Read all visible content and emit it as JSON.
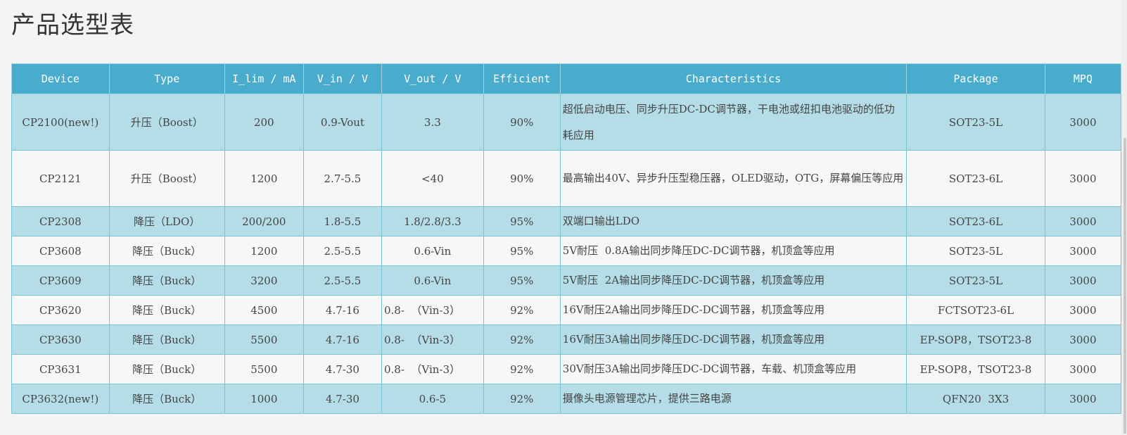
{
  "page": {
    "title": "产品选型表"
  },
  "table": {
    "headers": [
      "Device",
      "Type",
      "I_lim / mA",
      "V_in / V",
      "V_out / V",
      "Efficient",
      "Characteristics",
      "Package",
      "MPQ"
    ],
    "rows": [
      [
        "CP2100(new!)",
        "升压（Boost）",
        "200",
        "0.9-Vout",
        "3.3",
        "90%",
        "超低启动电压、同步升压DC-DC调节器，干电池或纽扣电池驱动的低功耗应用",
        "SOT23-5L",
        "3000"
      ],
      [
        "CP2121",
        "升压（Boost）",
        "1200",
        "2.7-5.5",
        "<40",
        "90%",
        "最高输出40V、异步升压型稳压器，OLED驱动，OTG，屏幕偏压等应用",
        "SOT23-6L",
        "3000"
      ],
      [
        "CP2308",
        "降压（LDO）",
        "200/200",
        "1.8-5.5",
        "1.8/2.8/3.3",
        "95%",
        "双端口输出LDO",
        "SOT23-6L",
        "3000"
      ],
      [
        "CP3608",
        "降压（Buck）",
        "1200",
        "2.5-5.5",
        "0.6-Vin",
        "95%",
        "5V耐压  0.8A输出同步降压DC-DC调节器，机顶盒等应用",
        "SOT23-5L",
        "3000"
      ],
      [
        "CP3609",
        "降压（Buck）",
        "3200",
        "2.5-5.5",
        "0.6-Vin",
        "95%",
        "5V耐压  2A输出同步降压DC-DC调节器，机顶盒等应用",
        "SOT23-5L",
        "3000"
      ],
      [
        "CP3620",
        "降压（Buck）",
        "4500",
        "4.7-16",
        "0.8-  （Vin-3）",
        "92%",
        "16V耐压2A输出同步降压DC-DC调节器，机顶盒等应用",
        "FCTSOT23-6L",
        "3000"
      ],
      [
        "CP3630",
        "降压（Buck）",
        "5500",
        "4.7-16",
        "0.8-  （Vin-3）",
        "92%",
        "16V耐压3A输出同步降压DC-DC调节器，机顶盒等应用",
        "EP-SOP8，TSOT23-8",
        "3000"
      ],
      [
        "CP3631",
        "降压（Buck）",
        "5500",
        "4.7-30",
        "0.8-  （Vin-3）",
        "92%",
        "30V耐压3A输出同步降压DC-DC调节器，车载、机顶盒等应用",
        "EP-SOP8，TSOT23-8",
        "3000"
      ],
      [
        "CP3632(new!)",
        "降压（Buck）",
        "1000",
        "4.7-30",
        "0.6-5",
        "92%",
        "摄像头电源管理芯片，提供三路电源",
        "QFN20  3X3",
        "3000"
      ]
    ]
  },
  "colors": {
    "header_bg": "#4aaccc",
    "row_odd_bg": "#b5dde8",
    "row_even_bg": "#f6f8f8",
    "border": "#7cc0d3"
  }
}
